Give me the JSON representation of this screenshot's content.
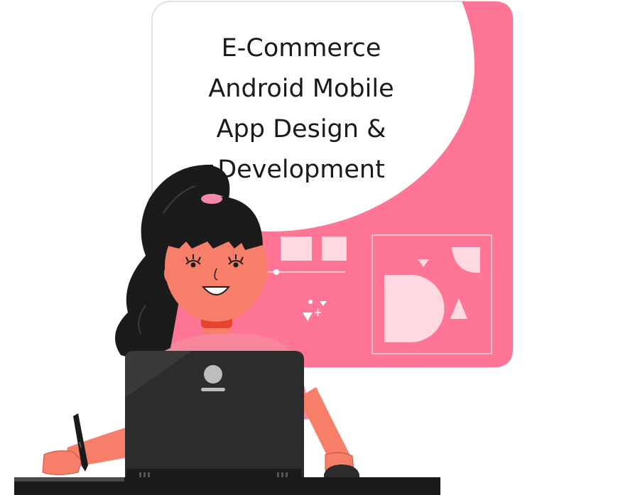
{
  "headline": {
    "lines": [
      "E-Commerce",
      "Android Mobile",
      "App Design &",
      "Development"
    ]
  },
  "colors": {
    "accent_pink": "#ff7596",
    "light_pink": "#ffd9e2",
    "laptop_dark": "#2c2c2c",
    "hair": "#1b1b1b",
    "skin": "#f77f6a",
    "choker": "#e8432e"
  },
  "icons": [
    "woman-illustration-icon",
    "laptop-icon",
    "laptop-logo-icon",
    "stylus-pen-icon",
    "mouse-icon",
    "shapes-icon"
  ]
}
